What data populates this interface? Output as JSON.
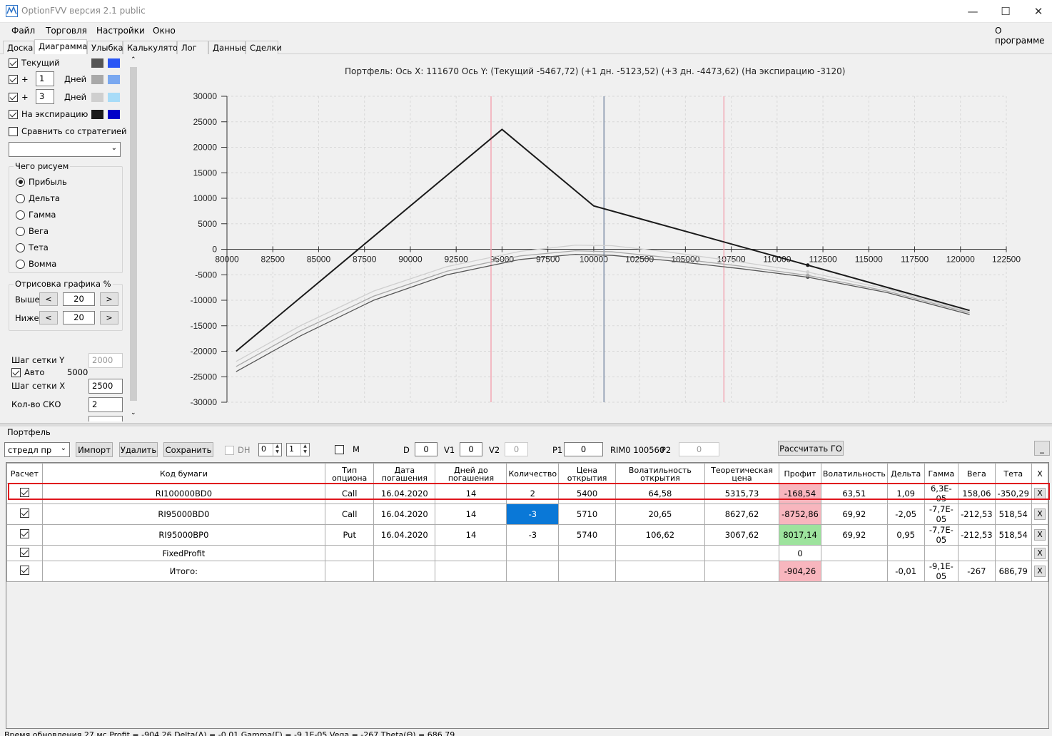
{
  "window": {
    "title": "OptionFVV версия 2.1 public",
    "minimize": "—",
    "maximize": "☐",
    "close": "✕"
  },
  "menu": {
    "file": "Файл",
    "trading": "Торговля",
    "settings": "Настройки",
    "window": "Окно",
    "about": "О программе"
  },
  "tabs": [
    "Доска",
    "Диаграмма",
    "Улыбка",
    "Калькулятор",
    "Лог",
    "Данные",
    "Сделки"
  ],
  "left": {
    "current": "Текущий",
    "plus1": "+",
    "days1": "1",
    "days_label1": "Дней",
    "plus2": "+",
    "days2": "3",
    "days_label2": "Дней",
    "expiry": "На экспирацию",
    "compare": "Сравнить со стратегией",
    "draw_group": "Чего рисуем",
    "radios": [
      "Прибыль",
      "Дельта",
      "Гамма",
      "Вега",
      "Тета",
      "Вомма"
    ],
    "draw_pct": "Отрисовка графика %",
    "above": "Выше",
    "above_val": "20",
    "below": "Ниже",
    "below_val": "20",
    "btn_left": "<",
    "btn_right": ">",
    "grid_y": "Шаг сетки Y",
    "grid_y_val": "2000",
    "auto": "Авто",
    "auto_val": "5000",
    "grid_x": "Шаг сетки X",
    "grid_x_val": "2500",
    "sko": "Кол-во СКО",
    "sko_val": "2",
    "colors": {
      "current_dark": "#555555",
      "current_light": "#2a56f5",
      "d1_dark": "#a8a8a8",
      "d1_light": "#7aa8f0",
      "d3_dark": "#cfcfcf",
      "d3_light": "#a8dcf8",
      "exp_dark": "#1a1a1a",
      "exp_light": "#0000c8"
    }
  },
  "chart_title": "Портфель: Ось X:  111670 Ось Y:   (Текущий -5467,72)  (+1 дн. -5123,52)  (+3 дн. -4473,62)  (На экспирацию -3120)",
  "chart_data": {
    "type": "line",
    "xlim": [
      80000,
      122500
    ],
    "ylim": [
      -30000,
      30000
    ],
    "x_ticks": [
      "80000",
      "82500",
      "85000",
      "87500",
      "90000",
      "92500",
      "95000",
      "97500",
      "100000",
      "102500",
      "105000",
      "107500",
      "110000",
      "112500",
      "115000",
      "117500",
      "120000",
      "122500"
    ],
    "y_ticks": [
      "30000",
      "25000",
      "20000",
      "15000",
      "10000",
      "5000",
      "0",
      "-5000",
      "-10000",
      "-15000",
      "-20000",
      "-25000",
      "-30000"
    ],
    "vlines": [
      {
        "x": 94400,
        "color": "#f2a8b4"
      },
      {
        "x": 100560,
        "color": "#8090a8"
      },
      {
        "x": 107100,
        "color": "#f2a8b4"
      }
    ],
    "series": [
      {
        "color": "#1a1a1a",
        "x": [
          80500,
          95000,
          100000,
          111670,
          120500
        ],
        "y": [
          -20000,
          23500,
          8500,
          -3120,
          -12000
        ]
      },
      {
        "color": "#555555",
        "x": [
          80500,
          84000,
          88000,
          92000,
          96000,
          99000,
          101000,
          104000,
          108000,
          111670,
          116000,
          120500
        ],
        "y": [
          -24000,
          -17000,
          -10000,
          -5000,
          -2000,
          -1000,
          -1200,
          -2200,
          -3800,
          -5468,
          -8500,
          -12800
        ]
      },
      {
        "color": "#a8a8a8",
        "x": [
          80500,
          84000,
          88000,
          92000,
          96000,
          99000,
          101000,
          104000,
          108000,
          111670,
          116000,
          120500
        ],
        "y": [
          -23000,
          -16000,
          -9200,
          -4300,
          -1300,
          -300,
          -500,
          -1600,
          -3300,
          -5124,
          -8200,
          -12500
        ]
      },
      {
        "color": "#cfcfcf",
        "x": [
          80500,
          84000,
          88000,
          92000,
          96000,
          99000,
          101000,
          104000,
          108000,
          111670,
          116000,
          120500
        ],
        "y": [
          -22000,
          -15000,
          -8200,
          -3400,
          -400,
          800,
          700,
          -500,
          -2500,
          -4474,
          -7800,
          -12300
        ]
      }
    ]
  },
  "portfolio": {
    "label": "Портфель",
    "strategy": "стредл пр",
    "import": "Импорт",
    "delete": "Удалить",
    "save": "Сохранить",
    "dh": "DH",
    "dh_a": "0",
    "dh_b": "1",
    "m": "M",
    "d": "D",
    "d_val": "0",
    "v1": "V1",
    "v1_val": "0",
    "v2": "V2",
    "v2_val": "0",
    "p1": "P1",
    "p1_val": "0",
    "rim": "RIM0 100560",
    "p2": "P2",
    "p2_val": "0",
    "calc_go": "Рассчитать ГО",
    "min": "_"
  },
  "table": {
    "headers": [
      "Расчет",
      "Код бумаги",
      "Тип опциона",
      "Дата погашения",
      "Дней до погашения",
      "Количество",
      "Цена открытия",
      "Волатильность открытия",
      "Теоретическая цена",
      "Профит",
      "Волатильность",
      "Дельта",
      "Гамма",
      "Вега",
      "Тета",
      "X"
    ],
    "rows": [
      [
        "RI100000BD0",
        "Call",
        "16.04.2020",
        "14",
        "2",
        "5400",
        "64,58",
        "5315,73",
        "-168,54",
        "63,51",
        "1,09",
        "6,3E-05",
        "158,06",
        "-350,29",
        "X"
      ],
      [
        "RI95000BD0",
        "Call",
        "16.04.2020",
        "14",
        "-3",
        "5710",
        "20,65",
        "8627,62",
        "-8752,86",
        "69,92",
        "-2,05",
        "-7,7E-05",
        "-212,53",
        "518,54",
        "X"
      ],
      [
        "RI95000BP0",
        "Put",
        "16.04.2020",
        "14",
        "-3",
        "5740",
        "106,62",
        "3067,62",
        "8017,14",
        "69,92",
        "0,95",
        "-7,7E-05",
        "-212,53",
        "518,54",
        "X"
      ],
      [
        "FixedProfit",
        "",
        "",
        "",
        "",
        "",
        "",
        "",
        "0",
        "",
        "",
        "",
        "",
        "",
        "X"
      ],
      [
        "Итого:",
        "",
        "",
        "",
        "",
        "",
        "",
        "",
        "-904,26",
        "",
        "-0,01",
        "-9,1E-05",
        "-267",
        "686,79",
        "X"
      ]
    ]
  },
  "status": "Время обновления 27 мс  Profit = -904,26 Delta(Δ) = -0,01 Gamma(Γ) = -9,1E-05 Vega = -267 Theta(Θ) = 686,79"
}
